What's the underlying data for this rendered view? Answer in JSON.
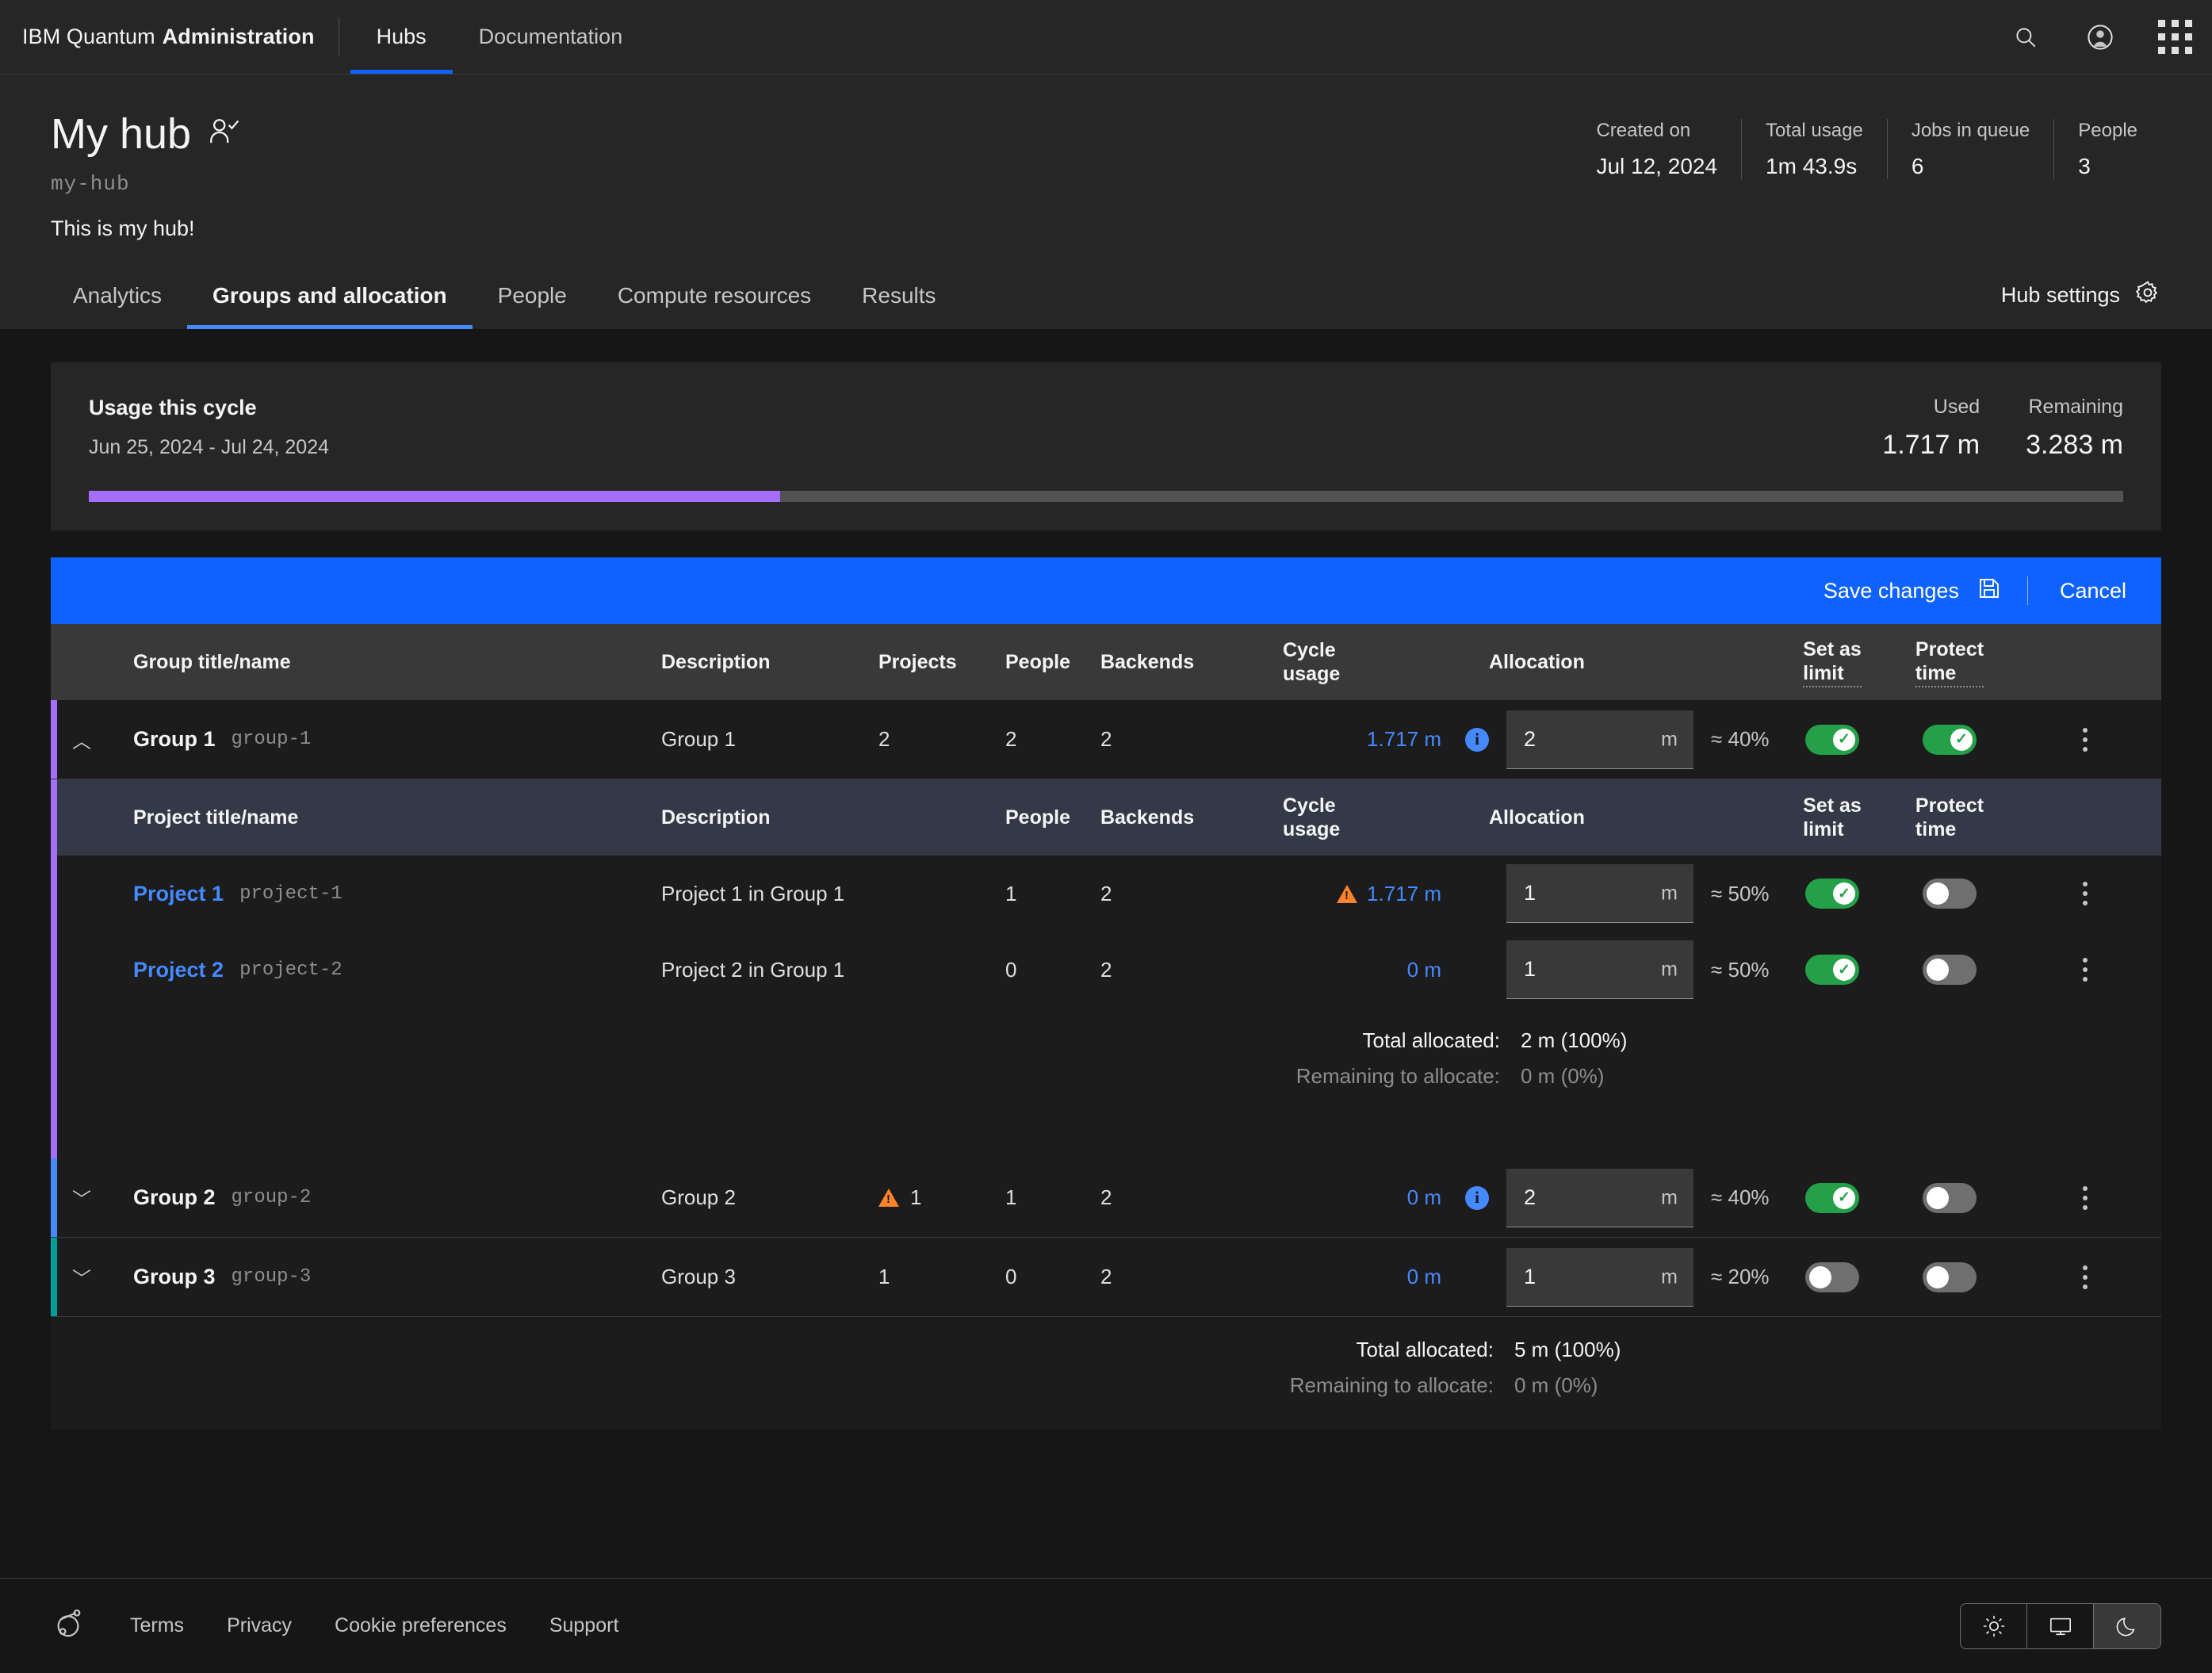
{
  "header": {
    "brand_prefix": "IBM Quantum",
    "brand_bold": "Administration",
    "nav": [
      {
        "label": "Hubs",
        "active": true
      },
      {
        "label": "Documentation",
        "active": false
      }
    ],
    "icons": [
      "search-icon",
      "user-avatar-icon",
      "app-switcher-icon"
    ]
  },
  "hub": {
    "title": "My hub",
    "verified_icon": "user-check-icon",
    "slug": "my-hub",
    "description": "This is my hub!",
    "stats": [
      {
        "label": "Created on",
        "value": "Jul 12, 2024"
      },
      {
        "label": "Total usage",
        "value": "1m 43.9s"
      },
      {
        "label": "Jobs in queue",
        "value": "6"
      },
      {
        "label": "People",
        "value": "3"
      }
    ],
    "settings_label": "Hub settings"
  },
  "tabs": [
    {
      "label": "Analytics",
      "active": false
    },
    {
      "label": "Groups and allocation",
      "active": true
    },
    {
      "label": "People",
      "active": false
    },
    {
      "label": "Compute resources",
      "active": false
    },
    {
      "label": "Results",
      "active": false
    }
  ],
  "usage_card": {
    "title": "Usage this cycle",
    "range": "Jun 25, 2024 - Jul 24, 2024",
    "used_label": "Used",
    "used_value": "1.717 m",
    "remaining_label": "Remaining",
    "remaining_value": "3.283 m",
    "progress_percent": 34,
    "bar_color": "#a56eff"
  },
  "action_bar": {
    "save_label": "Save changes",
    "save_icon": "save-icon",
    "cancel_label": "Cancel",
    "background": "#0f62fe"
  },
  "group_table": {
    "headers": {
      "name": "Group title/name",
      "description": "Description",
      "projects": "Projects",
      "people": "People",
      "backends": "Backends",
      "cycle_usage": "Cycle usage",
      "allocation": "Allocation",
      "set_as_limit": "Set as limit",
      "protect_time": "Protect time"
    },
    "project_headers": {
      "name": "Project title/name",
      "description": "Description",
      "people": "People",
      "backends": "Backends",
      "cycle_usage": "Cycle usage",
      "allocation": "Allocation",
      "set_as_limit": "Set as limit",
      "protect_time": "Protect time"
    },
    "groups": [
      {
        "title": "Group 1",
        "slug": "group-1",
        "description": "Group 1",
        "projects": "2",
        "projects_warning": false,
        "people": "2",
        "backends": "2",
        "cycle_usage": "1.717 m",
        "cycle_warning": false,
        "has_info": true,
        "allocation": "2",
        "unit": "m",
        "percent": "≈ 40%",
        "set_as_limit": true,
        "protect_time": true,
        "expanded": true,
        "accent": "#a56eff",
        "projects_list": [
          {
            "title": "Project 1",
            "slug": "project-1",
            "description": "Project 1 in Group 1",
            "people": "1",
            "backends": "2",
            "cycle_usage": "1.717 m",
            "cycle_warning": true,
            "allocation": "1",
            "unit": "m",
            "percent": "≈ 50%",
            "set_as_limit": true,
            "protect_time": false
          },
          {
            "title": "Project 2",
            "slug": "project-2",
            "description": "Project 2 in Group 1",
            "people": "0",
            "backends": "2",
            "cycle_usage": "0 m",
            "cycle_warning": false,
            "allocation": "1",
            "unit": "m",
            "percent": "≈ 50%",
            "set_as_limit": true,
            "protect_time": false
          }
        ],
        "totals": {
          "allocated_label": "Total allocated:",
          "allocated_value": "2 m (100%)",
          "remaining_label": "Remaining to allocate:",
          "remaining_value": "0 m (0%)"
        }
      },
      {
        "title": "Group 2",
        "slug": "group-2",
        "description": "Group 2",
        "projects": "1",
        "projects_warning": true,
        "people": "1",
        "backends": "2",
        "cycle_usage": "0 m",
        "cycle_warning": false,
        "has_info": true,
        "allocation": "2",
        "unit": "m",
        "percent": "≈ 40%",
        "set_as_limit": true,
        "protect_time": false,
        "expanded": false,
        "accent": "#4589ff"
      },
      {
        "title": "Group 3",
        "slug": "group-3",
        "description": "Group 3",
        "projects": "1",
        "projects_warning": false,
        "people": "0",
        "backends": "2",
        "cycle_usage": "0 m",
        "cycle_warning": false,
        "has_info": false,
        "allocation": "1",
        "unit": "m",
        "percent": "≈ 20%",
        "set_as_limit": false,
        "protect_time": false,
        "expanded": false,
        "accent": "#009d9a"
      }
    ],
    "grand_totals": {
      "allocated_label": "Total allocated:",
      "allocated_value": "5 m (100%)",
      "remaining_label": "Remaining to allocate:",
      "remaining_value": "0 m (0%)"
    }
  },
  "footer": {
    "logo_icon": "ibm-quantum-logo-icon",
    "links": [
      "Terms",
      "Privacy",
      "Cookie preferences",
      "Support"
    ],
    "theme_buttons": [
      {
        "icon": "sun-icon",
        "active": false
      },
      {
        "icon": "monitor-icon",
        "active": false
      },
      {
        "icon": "moon-icon",
        "active": true
      }
    ]
  }
}
